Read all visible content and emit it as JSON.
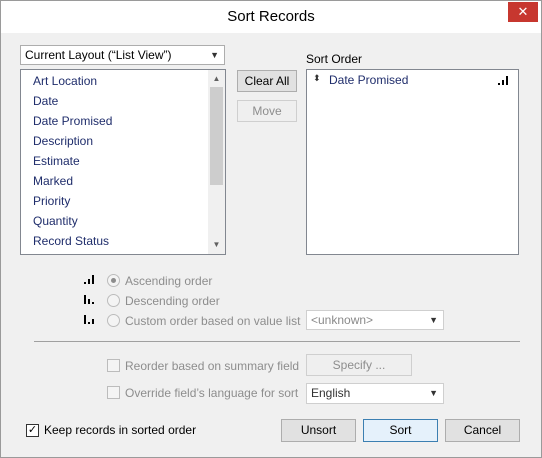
{
  "window": {
    "title": "Sort Records",
    "close_glyph": "✕"
  },
  "layout_select": {
    "value": "Current Layout (“List View”)"
  },
  "fields": {
    "items": [
      "Art Location",
      "Date",
      "Date Promised",
      "Description",
      "Estimate",
      "Marked",
      "Priority",
      "Quantity",
      "Record Status"
    ]
  },
  "buttons": {
    "clear_all": "Clear All",
    "move": "Move",
    "specify": "Specify ...",
    "unsort": "Unsort",
    "sort": "Sort",
    "cancel": "Cancel"
  },
  "sort_order": {
    "label": "Sort Order",
    "items": [
      {
        "name": "Date Promised",
        "direction": "ascending"
      }
    ]
  },
  "order_options": {
    "ascending": "Ascending order",
    "descending": "Descending order",
    "custom": "Custom order based on value list",
    "value_list_placeholder": "<unknown>",
    "selected": "ascending"
  },
  "options": {
    "reorder_summary": "Reorder based on summary field",
    "reorder_checked": false,
    "override_language": "Override field’s language for sort",
    "override_checked": false,
    "language_value": "English"
  },
  "keep_sorted": {
    "label": "Keep records in sorted order",
    "checked": true,
    "check_glyph": "✓"
  },
  "icons": {
    "arrow_up": "▲",
    "arrow_down": "▼",
    "sort_updown": "⬍"
  },
  "colors": {
    "field_text": "#1f2d6b",
    "close_button": "#c7372f"
  }
}
